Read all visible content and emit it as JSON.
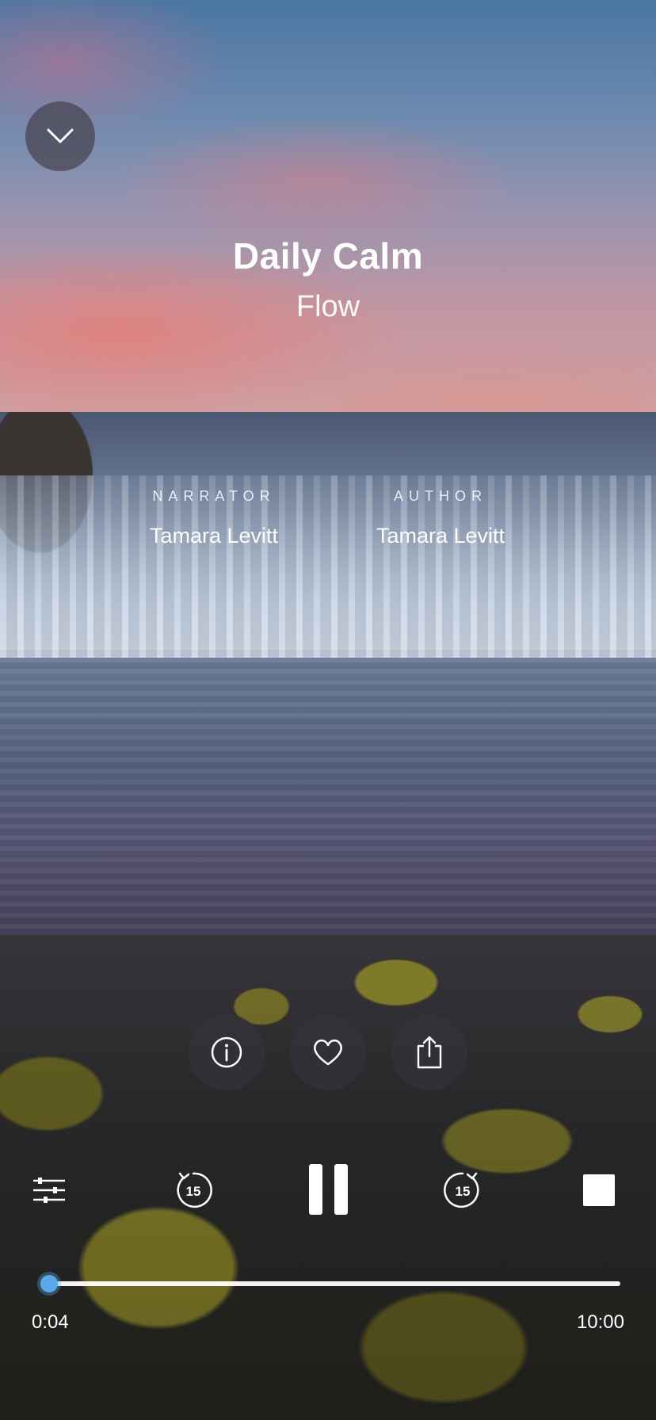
{
  "session": {
    "title": "Daily Calm",
    "subtitle": "Flow"
  },
  "credits": {
    "narrator_label": "NARRATOR",
    "narrator_name": "Tamara Levitt",
    "author_label": "AUTHOR",
    "author_name": "Tamara Levitt"
  },
  "icons": {
    "collapse": "chevron-down-icon",
    "info": "info-icon",
    "favorite": "heart-icon",
    "share": "share-icon",
    "settings": "sliders-icon",
    "rewind": "rewind-15-icon",
    "play_pause": "pause-icon",
    "forward": "forward-15-icon",
    "stop": "stop-icon"
  },
  "skip_seconds_label": "15",
  "playback": {
    "elapsed": "0:04",
    "duration": "10:00",
    "progress_fraction": 0.007
  },
  "colors": {
    "accent": "#5aa9ea",
    "button_bg": "#343238"
  }
}
